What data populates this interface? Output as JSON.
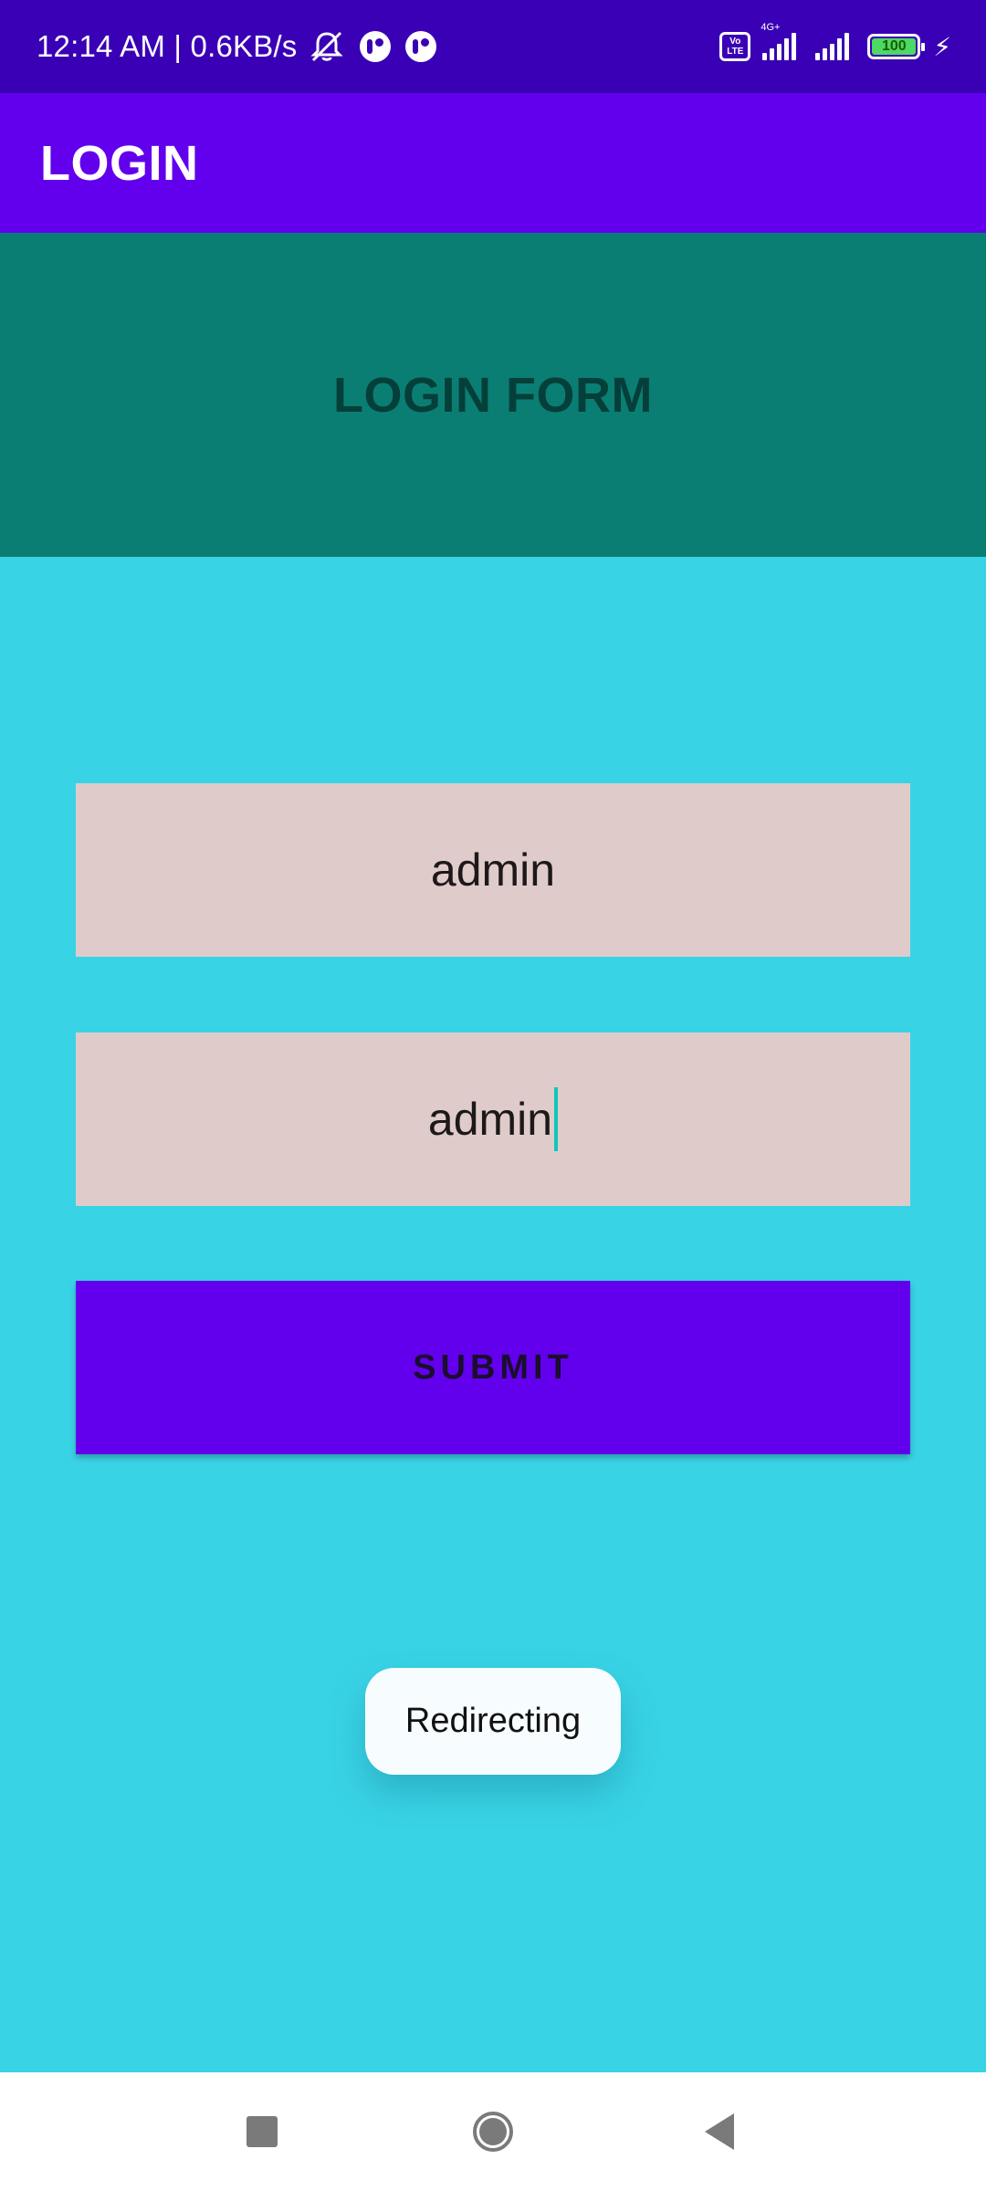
{
  "status_bar": {
    "time_speed": "12:14 AM | 0.6KB/s",
    "volte": "Vo\nLTE",
    "network": "4G+",
    "battery": "100",
    "icons": [
      "mute-icon",
      "notification-icon",
      "notification-icon",
      "volte-icon",
      "signal-icon",
      "signal-icon",
      "battery-icon",
      "charging-icon"
    ]
  },
  "app_bar": {
    "title": "LOGIN"
  },
  "banner": {
    "title": "LOGIN FORM"
  },
  "form": {
    "username_value": "admin",
    "password_value": "admin",
    "submit_label": "SUBMIT"
  },
  "toast": {
    "message": "Redirecting"
  },
  "nav_bar": {
    "icons": [
      "recent-apps-icon",
      "home-icon",
      "back-icon"
    ]
  },
  "colors": {
    "status_bar": "#3a00b5",
    "app_bar": "#6200ee",
    "banner": "#0b7e74",
    "background": "#39d3e6",
    "field": "#e0cbcb",
    "submit": "#6200ee"
  }
}
